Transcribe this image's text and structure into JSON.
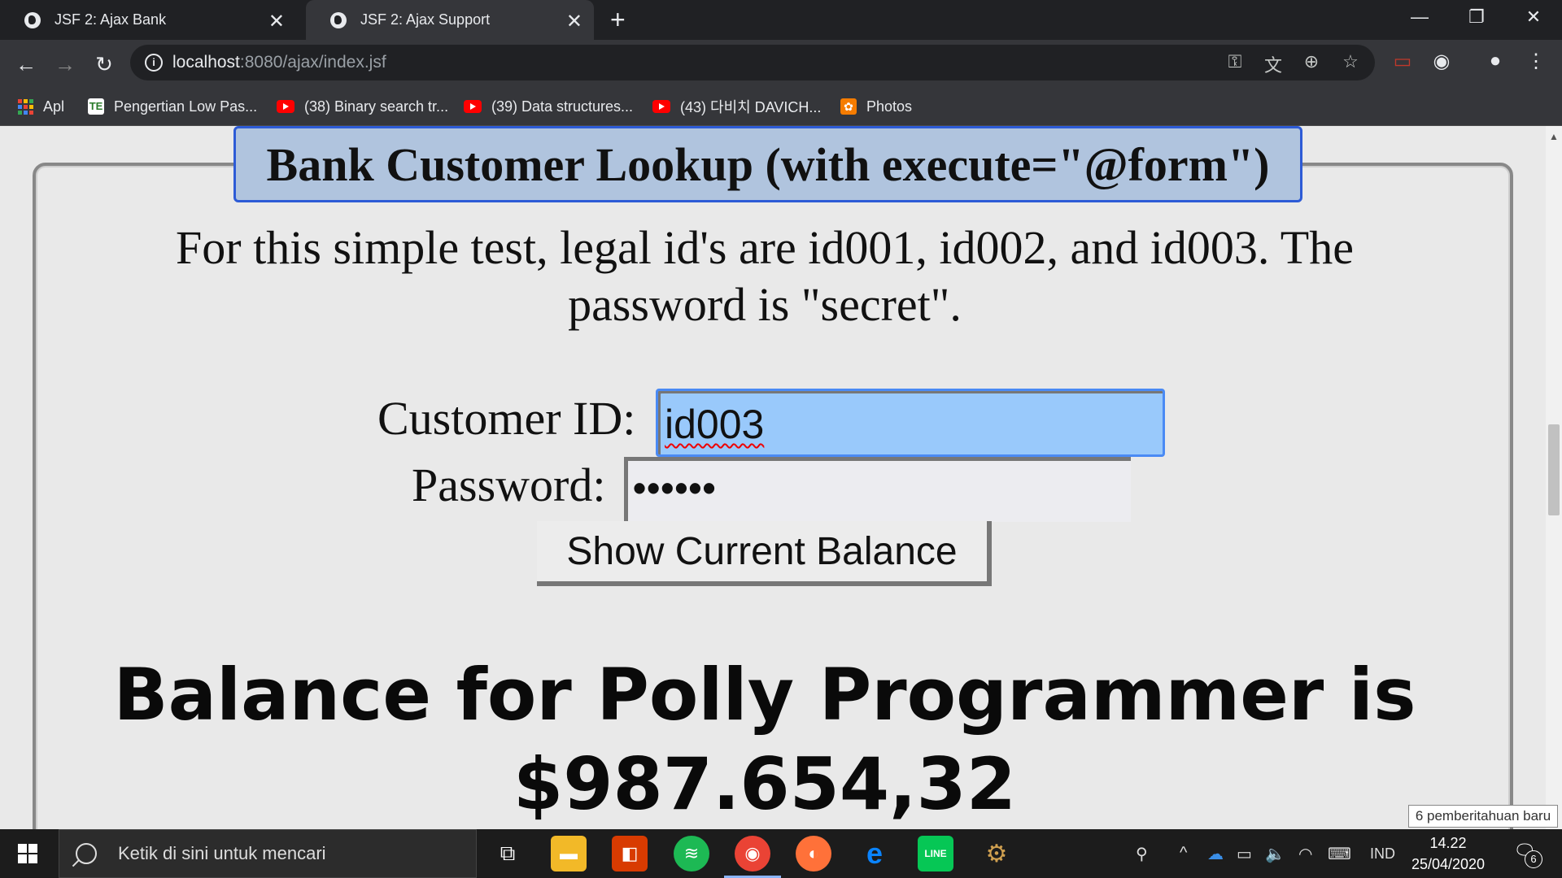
{
  "browser": {
    "tabs": [
      {
        "title": "JSF 2: Ajax Bank",
        "active": false
      },
      {
        "title": "JSF 2: Ajax Support",
        "active": true
      }
    ],
    "new_tab": "+",
    "window_controls": {
      "minimize": "—",
      "restore": "❐",
      "close": "✕"
    },
    "url_host": "localhost",
    "url_rest": ":8080/ajax/index.jsf",
    "bookmarks": [
      {
        "label": "Apl",
        "icon": "apps-grid-icon"
      },
      {
        "label": "Pengertian Low Pas...",
        "icon": "te-icon"
      },
      {
        "label": "(38) Binary search tr...",
        "icon": "youtube-icon"
      },
      {
        "label": "(39) Data structures...",
        "icon": "youtube-icon"
      },
      {
        "label": "(43) 다비치 DAVICH...",
        "icon": "youtube-icon"
      },
      {
        "label": "Photos",
        "icon": "photos-icon"
      }
    ]
  },
  "page": {
    "legend": "Bank Customer Lookup (with execute=\"@form\")",
    "intro": "For this simple test, legal id's are id001, id002, and id003. The password is \"secret\".",
    "customer_id_label": "Customer ID:",
    "customer_id_value": "id003",
    "password_label": "Password:",
    "password_value": "••••••",
    "button_label": "Show Current Balance",
    "balance_line1": "Balance for Polly Programmer is",
    "balance_line2": "$987.654,32"
  },
  "notification": "6 pemberitahuan baru",
  "taskbar": {
    "search_placeholder": "Ketik di sini untuk mencari",
    "language": "IND",
    "time": "14.22",
    "date": "25/04/2020",
    "notification_count": "6"
  },
  "colors": {
    "legend_bg": "#b0c4de",
    "legend_border": "#2d5bd6",
    "input_focus_bg": "#99c9fb",
    "chrome_dark": "#202124",
    "chrome_toolbar": "#35363a"
  }
}
